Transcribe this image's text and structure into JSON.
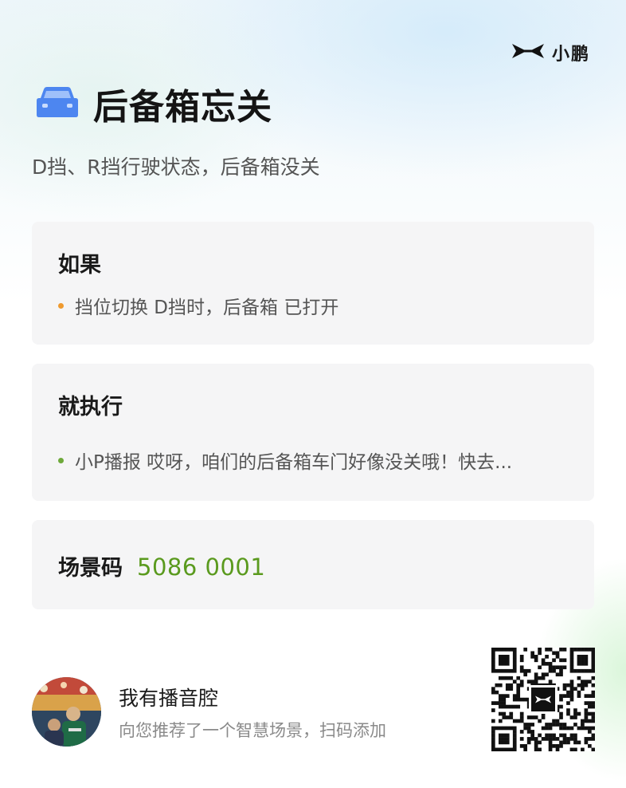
{
  "brand": {
    "name": "小鹏",
    "logo_icon": "xpeng-x-logo-icon"
  },
  "header": {
    "icon": "car-icon",
    "icon_color": "#4d86f0",
    "title": "后备箱忘关",
    "subtitle": "D挡、R挡行驶状态，后备箱没关"
  },
  "condition": {
    "label": "如果",
    "item": "挡位切换 D挡时，后备箱 已打开",
    "dot_color": "#ef9a2e"
  },
  "action": {
    "label": "就执行",
    "item": "小P播报 哎呀，咱们的后备箱车门好像没关哦！快去...",
    "dot_color": "#6ea93a"
  },
  "scene_code": {
    "label": "场景码",
    "value": "5086 0001",
    "value_color": "#5a9a1e"
  },
  "share": {
    "avatar": "user-avatar-photo",
    "username": "我有播音腔",
    "description": "向您推荐了一个智慧场景，扫码添加",
    "qr": "qr-code"
  }
}
